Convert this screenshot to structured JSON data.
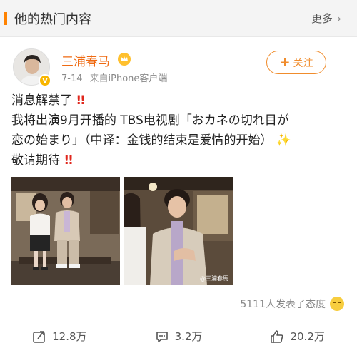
{
  "section": {
    "title": "他的热门内容",
    "more_label": "更多"
  },
  "post": {
    "user_name": "三浦春马",
    "date": "7-14",
    "source": "来自iPhone客户端",
    "follow_label": "关注",
    "lines": [
      "消息解禁了",
      "我将出演9月开播的 TBS电视剧「おカネの切れ目が",
      "恋の始まり」（中译：金钱的结束是爱情的开始）",
      "敬请期待"
    ],
    "watermark": "@三浦春馬",
    "reactions_text": "5111人发表了态度"
  },
  "actions": {
    "repost": "12.8万",
    "comment": "3.2万",
    "like": "20.2万"
  },
  "icons": {
    "more": "chevron-right-icon",
    "verified": "verified-icon",
    "member": "member-badge-icon",
    "repost": "repost-icon",
    "comment": "comment-icon",
    "like": "like-icon"
  },
  "colors": {
    "accent": "#ff8200",
    "username": "#ef6a12",
    "follow": "#f08c2c",
    "exclaim": "#e0271d"
  }
}
